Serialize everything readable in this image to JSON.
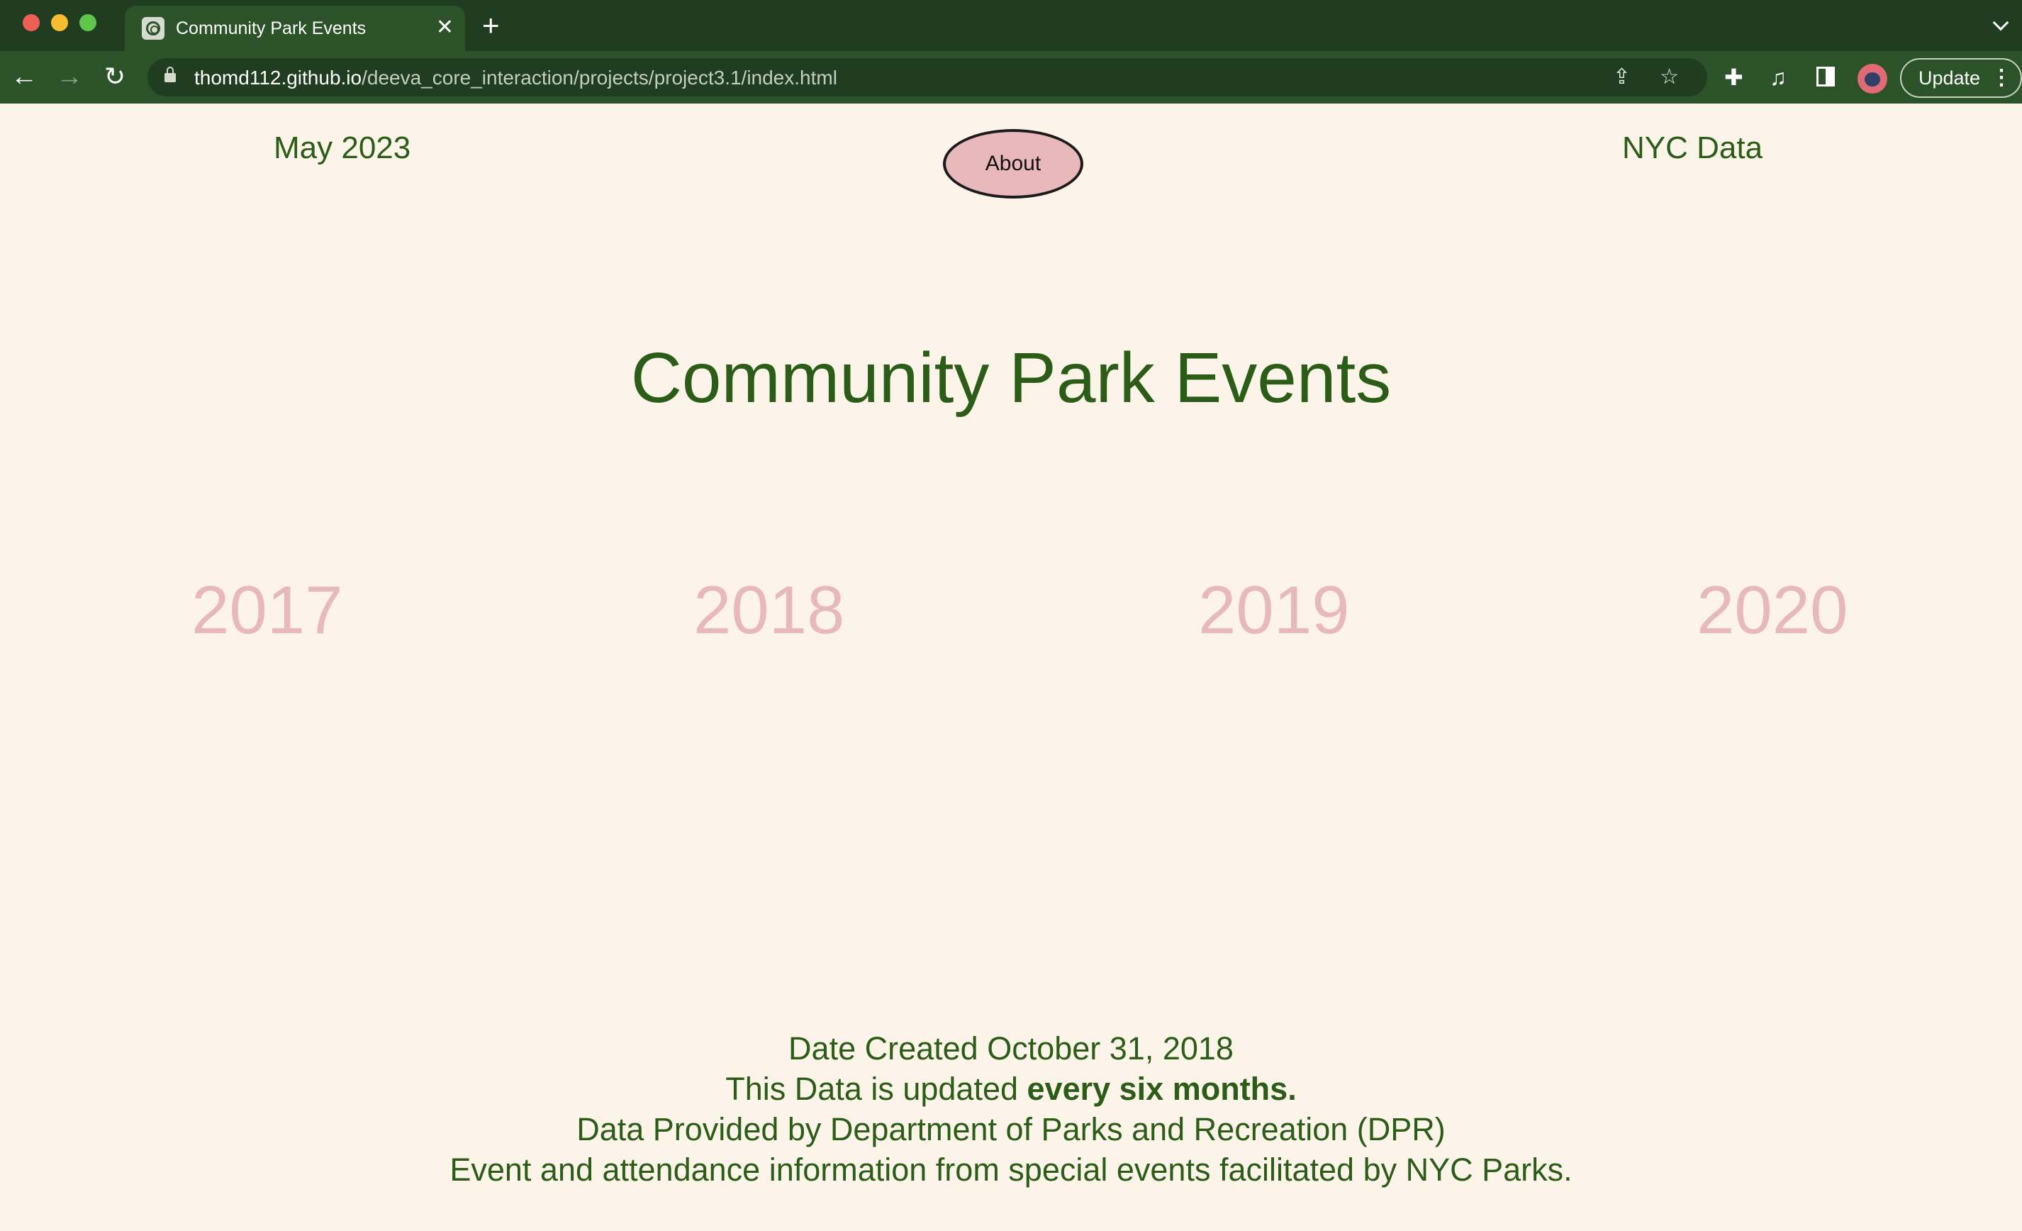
{
  "browser": {
    "tab_title": "Community Park Events",
    "tab_close": "✕",
    "new_tab": "+",
    "url_host": "thomd112.github.io",
    "url_path": "/deeva_core_interaction/projects/project3.1/index.html",
    "update_label": "Update",
    "update_menu": "⋮",
    "icons": {
      "back": "←",
      "forward": "→",
      "reload": "↻",
      "share": "⇪",
      "star": "☆",
      "extensions": "✚",
      "media": "♫"
    },
    "colors": {
      "tab_bar": "#213d21",
      "toolbar": "#2c522a"
    }
  },
  "page": {
    "nav": {
      "left": "May 2023",
      "about": "About",
      "right": "NYC Data"
    },
    "title": "Community Park Events",
    "years": [
      "2017",
      "2018",
      "2019",
      "2020"
    ],
    "footer": {
      "created": "Date Created October 31, 2018",
      "updated_prefix": "This Data is updated ",
      "updated_bold": "every six months.",
      "provider": "Data Provided by Department of Parks and Recreation (DPR)",
      "description": "Event and attendance information from special events facilitated by NYC Parks."
    },
    "colors": {
      "background": "#fcf4e8",
      "text": "#2c5d18",
      "year": "#e7b9bd",
      "about_button": "#e9b8ba"
    }
  }
}
